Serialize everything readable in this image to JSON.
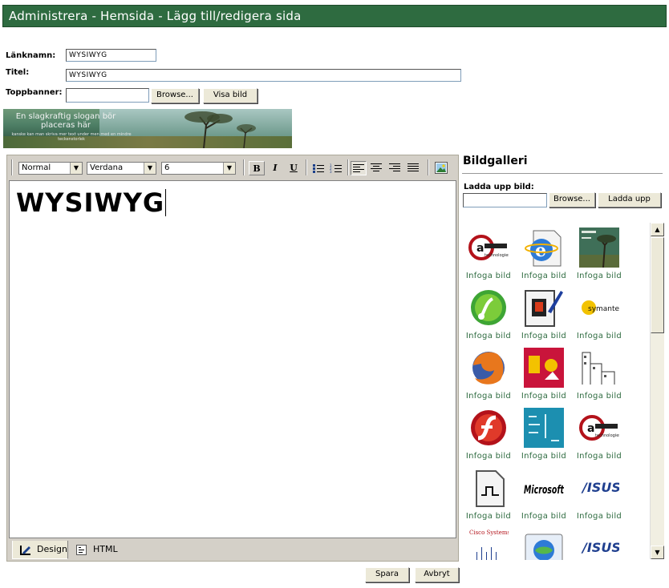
{
  "titlebar": {
    "title": "Administrera - Hemsida - Lägg till/redigera sida"
  },
  "form": {
    "linkname_label": "Länknamn:",
    "linkname_value": "WYSIWYG",
    "title_label": "Titel:",
    "title_value": "WYSIWYG",
    "topbanner_label": "Toppbanner:",
    "topbanner_value": "",
    "browse_label": "Browse...",
    "show_image_label": "Visa bild"
  },
  "banner": {
    "slogan": "En slagkraftig slogan bör placeras här",
    "subtext": "kanske kan man skriva mer text under men med en mindre teckenstorlek"
  },
  "toolbar": {
    "format_value": "Normal",
    "font_value": "Verdana",
    "size_value": "6",
    "bold": "B",
    "italic": "I",
    "underline": "U"
  },
  "editor": {
    "content": "WYSIWYG"
  },
  "tabs": {
    "design": "Design",
    "html": "HTML"
  },
  "gallery": {
    "title": "Bildgalleri",
    "upload_label": "Ladda upp bild:",
    "browse_label": "Browse...",
    "upload_button": "Ladda upp",
    "insert_label": "Infoga bild",
    "items": [
      {
        "icon": "data-logo-icon"
      },
      {
        "icon": "ie-document-icon"
      },
      {
        "icon": "landscape-photo-icon"
      },
      {
        "icon": "green-sphere-icon"
      },
      {
        "icon": "page-edit-icon"
      },
      {
        "icon": "symantec-logo-icon"
      },
      {
        "icon": "firefox-logo-icon"
      },
      {
        "icon": "red-poster-icon"
      },
      {
        "icon": "city-sketch-icon"
      },
      {
        "icon": "flash-logo-icon"
      },
      {
        "icon": "teal-text-icon"
      },
      {
        "icon": "data-logo-icon"
      },
      {
        "icon": "waveform-doc-icon"
      },
      {
        "icon": "microsoft-logo-icon"
      },
      {
        "icon": "asus-logo-icon"
      },
      {
        "icon": "cisco-logo-icon"
      },
      {
        "icon": "ie-globe-icon"
      },
      {
        "icon": "asus-logo-icon"
      }
    ],
    "logo_texts": {
      "microsoft": "Microsoft",
      "asus": "/ISUS",
      "cisco": "Cisco Systems"
    }
  },
  "actions": {
    "save": "Spara",
    "cancel": "Avbryt"
  }
}
